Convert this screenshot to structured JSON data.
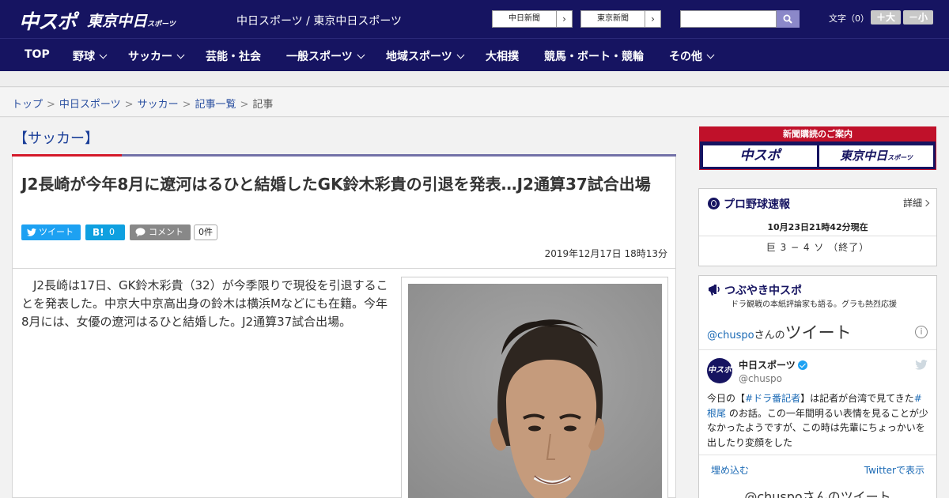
{
  "header": {
    "logo_main": "中スポ",
    "logo_sub": "東京中日",
    "logo_sub_small": "スポーツ",
    "site_name": "中日スポーツ / 東京中日スポーツ",
    "newspaper_links": [
      "中日新聞",
      "東京新聞"
    ],
    "font_size_label": "文字（0）",
    "font_larger": "＋大",
    "font_smaller": "－小",
    "colors": {
      "navy": "#161461",
      "accent_red": "#d4192a"
    }
  },
  "nav": [
    {
      "label": "TOP",
      "has_menu": false
    },
    {
      "label": "野球",
      "has_menu": true
    },
    {
      "label": "サッカー",
      "has_menu": true
    },
    {
      "label": "芸能・社会",
      "has_menu": false
    },
    {
      "label": "一般スポーツ",
      "has_menu": true
    },
    {
      "label": "地域スポーツ",
      "has_menu": true
    },
    {
      "label": "大相撲",
      "has_menu": false
    },
    {
      "label": "競馬・ボート・競輪",
      "has_menu": false
    },
    {
      "label": "その他",
      "has_menu": true
    }
  ],
  "breadcrumb": [
    "トップ",
    "中日スポーツ",
    "サッカー",
    "記事一覧",
    "記事"
  ],
  "article": {
    "category": "【サッカー】",
    "title": "J2長崎が今年8月に遼河はるひと結婚したGK鈴木彩貴の引退を発表…J2通算37試合出場",
    "tweet_label": "ツイート",
    "hatena_label": "B!",
    "hatena_count": "0",
    "comment_label": "コメント",
    "comment_count": "0件",
    "date": "2019年12月17日 18時13分",
    "body": "　J2長崎は17日、GK鈴木彩貴（32）が今季限りで現役を引退することを発表した。中京大中京高出身の鈴木は横浜Mなどにも在籍。今年8月には、女優の遼河はるひと結婚した。J2通算37試合出場。"
  },
  "sidebar": {
    "promo": {
      "banner": "新聞購読のご案内",
      "logo_1": "中スポ",
      "logo_2": "東京中日",
      "logo_2_small": "スポーツ"
    },
    "baseball": {
      "title": "プロ野球速報",
      "more": "詳細",
      "as_of": "10月23日21時42分現在",
      "score": "巨 3 − 4 ソ （終了）"
    },
    "tsubuyaki": {
      "title": "つぶやき中スポ",
      "subtitle": "ドラ観戦の本紙評論家も語る。グラも熱烈応援",
      "handle": "@chuspo",
      "suffix_small": "さんの",
      "suffix_big": "ツイート",
      "info": "i",
      "avatar_text": "中スポ",
      "account_name": "中日スポーツ",
      "account_handle": "@chuspo",
      "tweet_pre": "今日の【",
      "tweet_tag1": "#ドラ番記者",
      "tweet_mid": "】は記者が台湾で見てきた",
      "tweet_tag2": "#根尾",
      "tweet_post": " のお話。この一年間明るい表情を見ることが少なかったようですが、この時は先輩にちょっかいを出したり変顔をした",
      "embed": "埋め込む",
      "view_on_twitter": "Twitterで表示",
      "next_header": "@chuspoさんのツイート"
    }
  }
}
